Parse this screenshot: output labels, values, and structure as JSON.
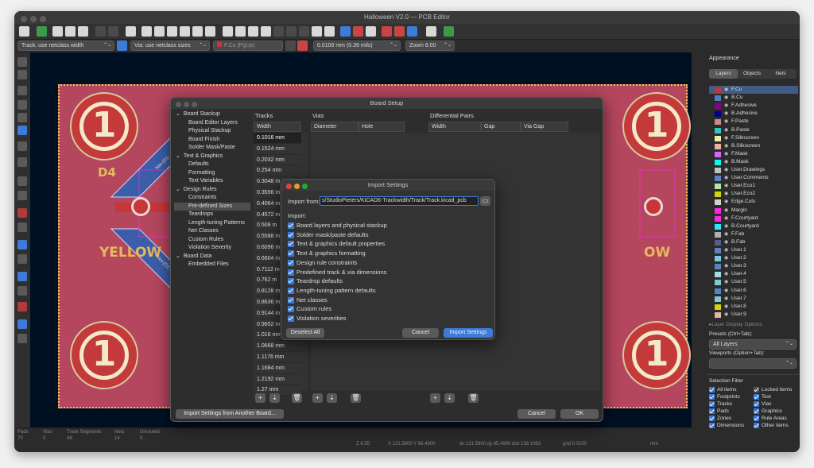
{
  "window": {
    "title": "Halloween V2.0 — PCB Editor"
  },
  "options_bar": {
    "track": "Track: use netclass width",
    "via": "Via: use netclass sizes",
    "layer": "F.Cu (PgUp)",
    "grid": "0.0100 mm (0.39 mils)",
    "zoom": "Zoom 8.00"
  },
  "board": {
    "pad_number": "1",
    "ref_label": "D4",
    "color_label": "YELLOW",
    "net_top": "Net-(D1-...",
    "net_bottom": "Net-(D1-...",
    "partial_label": "OW"
  },
  "appearance": {
    "title": "Appearance",
    "tabs": [
      "Layers",
      "Objects",
      "Nets"
    ],
    "layers": [
      {
        "name": "F.Cu",
        "color": "#c83737"
      },
      {
        "name": "B.Cu",
        "color": "#4d7fc4"
      },
      {
        "name": "F.Adhesive",
        "color": "#84008c"
      },
      {
        "name": "B.Adhesive",
        "color": "#000084"
      },
      {
        "name": "F.Paste",
        "color": "#cc8b8b"
      },
      {
        "name": "B.Paste",
        "color": "#2ec8c8"
      },
      {
        "name": "F.Silkscreen",
        "color": "#f2eda1"
      },
      {
        "name": "B.Silkscreen",
        "color": "#e8b2a7"
      },
      {
        "name": "F.Mask",
        "color": "#d864ff"
      },
      {
        "name": "B.Mask",
        "color": "#02ffee"
      },
      {
        "name": "User.Drawings",
        "color": "#c2c2c2"
      },
      {
        "name": "User.Comments",
        "color": "#5984c4"
      },
      {
        "name": "User.Eco1",
        "color": "#b5e5a5"
      },
      {
        "name": "User.Eco2",
        "color": "#d4d40a"
      },
      {
        "name": "Edge.Cuts",
        "color": "#d0d2cd"
      },
      {
        "name": "Margin",
        "color": "#ff26e2"
      },
      {
        "name": "F.Courtyard",
        "color": "#ff26e2"
      },
      {
        "name": "B.Courtyard",
        "color": "#26e9ff"
      },
      {
        "name": "F.Fab",
        "color": "#afafaf"
      },
      {
        "name": "B.Fab",
        "color": "#585d84"
      },
      {
        "name": "User.1",
        "color": "#5984c4"
      },
      {
        "name": "User.2",
        "color": "#7dcbd6"
      },
      {
        "name": "User.3",
        "color": "#5984c4"
      },
      {
        "name": "User.4",
        "color": "#a3dbe3"
      },
      {
        "name": "User.5",
        "color": "#7dcbd6"
      },
      {
        "name": "User.6",
        "color": "#5984c4"
      },
      {
        "name": "User.7",
        "color": "#7dcbd6"
      },
      {
        "name": "User.8",
        "color": "#d4d40a"
      },
      {
        "name": "User.9",
        "color": "#e8b2a7"
      }
    ],
    "layer_display_options": "Layer Display Options",
    "presets_label": "Presets (Ctrl+Tab):",
    "presets_value": "All Layers",
    "viewports_label": "Viewports (Option+Tab):"
  },
  "selection_filter": {
    "title": "Selection Filter",
    "items": [
      {
        "label": "All items",
        "checked": true
      },
      {
        "label": "Locked items",
        "checked": false
      },
      {
        "label": "Footprints",
        "checked": true
      },
      {
        "label": "Text",
        "checked": true
      },
      {
        "label": "Tracks",
        "checked": true
      },
      {
        "label": "Vias",
        "checked": true
      },
      {
        "label": "Pads",
        "checked": true
      },
      {
        "label": "Graphics",
        "checked": true
      },
      {
        "label": "Zones",
        "checked": true
      },
      {
        "label": "Rule Areas",
        "checked": true
      },
      {
        "label": "Dimensions",
        "checked": true
      },
      {
        "label": "Other items",
        "checked": true
      }
    ]
  },
  "status": {
    "labels": [
      "Pads",
      "Vias",
      "Track Segments",
      "Nets",
      "Unrouted"
    ],
    "values": [
      "70",
      "0",
      "48",
      "14",
      "0"
    ],
    "z": "Z 6.55",
    "xy": "X 121.5900  Y 65.4900",
    "dxdy": "dx 121.5900  dy 65.4900  dist 138.1063",
    "grid": "grid 0.0100",
    "units": "mm"
  },
  "board_setup": {
    "title": "Board Setup",
    "tree": [
      {
        "label": "Board Stackup",
        "level": 0,
        "arrow": "⌄"
      },
      {
        "label": "Board Editor Layers",
        "level": 1
      },
      {
        "label": "Physical Stackup",
        "level": 1
      },
      {
        "label": "Board Finish",
        "level": 1
      },
      {
        "label": "Solder Mask/Paste",
        "level": 1
      },
      {
        "label": "Text & Graphics",
        "level": 0,
        "arrow": "⌄"
      },
      {
        "label": "Defaults",
        "level": 1
      },
      {
        "label": "Formatting",
        "level": 1
      },
      {
        "label": "Text Variables",
        "level": 1
      },
      {
        "label": "Design Rules",
        "level": 0,
        "arrow": "⌄"
      },
      {
        "label": "Constraints",
        "level": 1
      },
      {
        "label": "Pre-defined Sizes",
        "level": 1,
        "selected": true
      },
      {
        "label": "Teardrops",
        "level": 1
      },
      {
        "label": "Length-tuning Patterns",
        "level": 1
      },
      {
        "label": "Net Classes",
        "level": 1
      },
      {
        "label": "Custom Rules",
        "level": 1
      },
      {
        "label": "Violation Severity",
        "level": 1
      },
      {
        "label": "Board Data",
        "level": 0,
        "arrow": "⌄"
      },
      {
        "label": "Embedded Files",
        "level": 1
      }
    ],
    "tracks_title": "Tracks",
    "tracks_header": "Width",
    "tracks": [
      "0.1016 mm",
      "0.1524 mm",
      "0.2032 mm",
      "0.254 mm",
      "0.3048 m",
      "0.3556 m",
      "0.4064 m",
      "0.4572 m",
      "0.508 m",
      "0.5588 m",
      "0.6096 m",
      "0.6604 m",
      "0.7112 m",
      "0.762 m",
      "0.8128 m",
      "0.8636 m",
      "0.9144 m",
      "0.9652 m",
      "1.016 mm",
      "1.0668 mm",
      "1.1176 mm",
      "1.1684 mm",
      "1.2192 mm",
      "1.27 mm"
    ],
    "vias_title": "Vias",
    "vias_headers": [
      "Diameter",
      "Hole"
    ],
    "diff_title": "Differential Pairs",
    "diff_headers": [
      "Width",
      "Gap",
      "Via Gap"
    ],
    "import_button": "Import Settings from Another Board...",
    "cancel": "Cancel",
    "ok": "OK"
  },
  "import_settings": {
    "title": "Import Settings",
    "from_label": "Import from:",
    "from_value": "s/StudioPieters/KiCAD6-Trackwidth/Track/Track.kicad_pcb",
    "import_label": "Import:",
    "options": [
      "Board layers and physical stackup",
      "Solder mask/paste defaults",
      "Text & graphics default properties",
      "Text & graphics formatting",
      "Design rule constraints",
      "Predefined track & via dimensions",
      "Teardrop defaults",
      "Length-tuning pattern defaults",
      "Net classes",
      "Custom rules",
      "Violation severities"
    ],
    "deselect_all": "Deselect All",
    "cancel": "Cancel",
    "import": "Import Settings"
  }
}
